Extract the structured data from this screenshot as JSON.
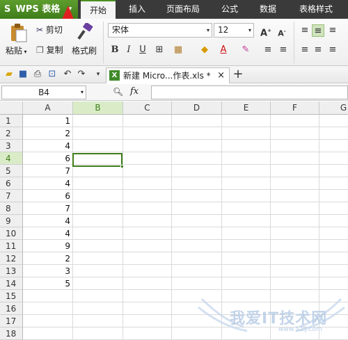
{
  "app": {
    "title": "WPS 表格",
    "logo_letter": "S",
    "dropdown_glyph": "▾"
  },
  "menu_tabs": [
    "开始",
    "插入",
    "页面布局",
    "公式",
    "数据",
    "表格样式"
  ],
  "ribbon": {
    "paste_label": "粘贴",
    "cut_label": "剪切",
    "copy_label": "复制",
    "format_painter_label": "格式刷",
    "font_name": "宋体",
    "font_size": "12",
    "bold": "B",
    "italic": "I",
    "underline": "U",
    "grow_font": "A",
    "shrink_font": "A"
  },
  "quick_access": {
    "new_tab_glyph": "+"
  },
  "document_tab": {
    "title": "新建 Micro...作表.xls *",
    "close_glyph": "×"
  },
  "formula_bar": {
    "name_box": "B4",
    "fx_label": "fx",
    "formula": ""
  },
  "sheet": {
    "columns": [
      "A",
      "B",
      "C",
      "D",
      "E",
      "F",
      "G"
    ],
    "selected_column": "B",
    "selected_row": "4",
    "rows": [
      {
        "num": "1",
        "a": "1"
      },
      {
        "num": "2",
        "a": "2"
      },
      {
        "num": "3",
        "a": "4"
      },
      {
        "num": "4",
        "a": "6"
      },
      {
        "num": "5",
        "a": "7"
      },
      {
        "num": "6",
        "a": "4"
      },
      {
        "num": "7",
        "a": "6"
      },
      {
        "num": "8",
        "a": "7"
      },
      {
        "num": "9",
        "a": "4"
      },
      {
        "num": "10",
        "a": "4"
      },
      {
        "num": "11",
        "a": "9"
      },
      {
        "num": "12",
        "a": "2"
      },
      {
        "num": "13",
        "a": "3"
      },
      {
        "num": "14",
        "a": "5"
      },
      {
        "num": "15",
        "a": ""
      },
      {
        "num": "16",
        "a": ""
      },
      {
        "num": "17",
        "a": ""
      },
      {
        "num": "18",
        "a": ""
      }
    ]
  },
  "watermark": {
    "text": "我爱IT技术网",
    "url": "www.52ij.com"
  },
  "colors": {
    "accent": "#3f7d1a",
    "menubar": "#3a3a3a",
    "arrow": "#e02020"
  }
}
